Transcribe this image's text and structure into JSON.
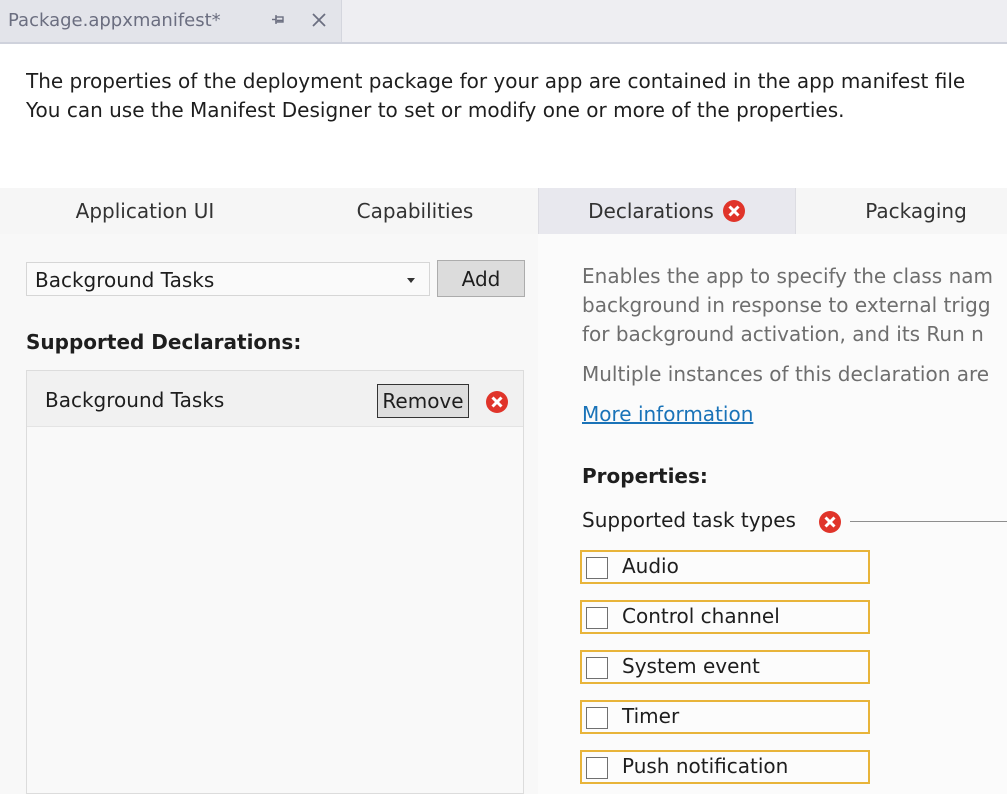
{
  "document_tab": {
    "title": "Package.appxmanifest*"
  },
  "intro": {
    "line1": "The properties of the deployment package for your app are contained in the app manifest file",
    "line2": "You can use the Manifest Designer to set or modify one or more of the properties."
  },
  "tabs": [
    {
      "label": "Application UI",
      "active": false
    },
    {
      "label": "Capabilities",
      "active": false
    },
    {
      "label": "Declarations",
      "active": true,
      "has_error": true
    },
    {
      "label": "Packaging",
      "active": false
    }
  ],
  "available_declarations": {
    "selected": "Background Tasks",
    "add_label": "Add"
  },
  "supported_declarations": {
    "heading": "Supported Declarations:",
    "items": [
      {
        "label": "Background Tasks",
        "remove_label": "Remove",
        "has_error": true
      }
    ]
  },
  "details": {
    "description": [
      "Enables the app to specify the class nam",
      "background in response to external trigg",
      "for background activation, and its Run n"
    ],
    "multiple_note": "Multiple instances of this declaration are",
    "more_info_link": "More information",
    "properties_heading": "Properties:",
    "supported_task_types_label": "Supported task types",
    "task_types": [
      {
        "label": "Audio",
        "checked": false
      },
      {
        "label": "Control channel",
        "checked": false
      },
      {
        "label": "System event",
        "checked": false
      },
      {
        "label": "Timer",
        "checked": false
      },
      {
        "label": "Push notification",
        "checked": false
      }
    ]
  },
  "colors": {
    "error_red": "#e0342a",
    "validation_border": "#e8b43a",
    "link_blue": "#1a73b8"
  }
}
